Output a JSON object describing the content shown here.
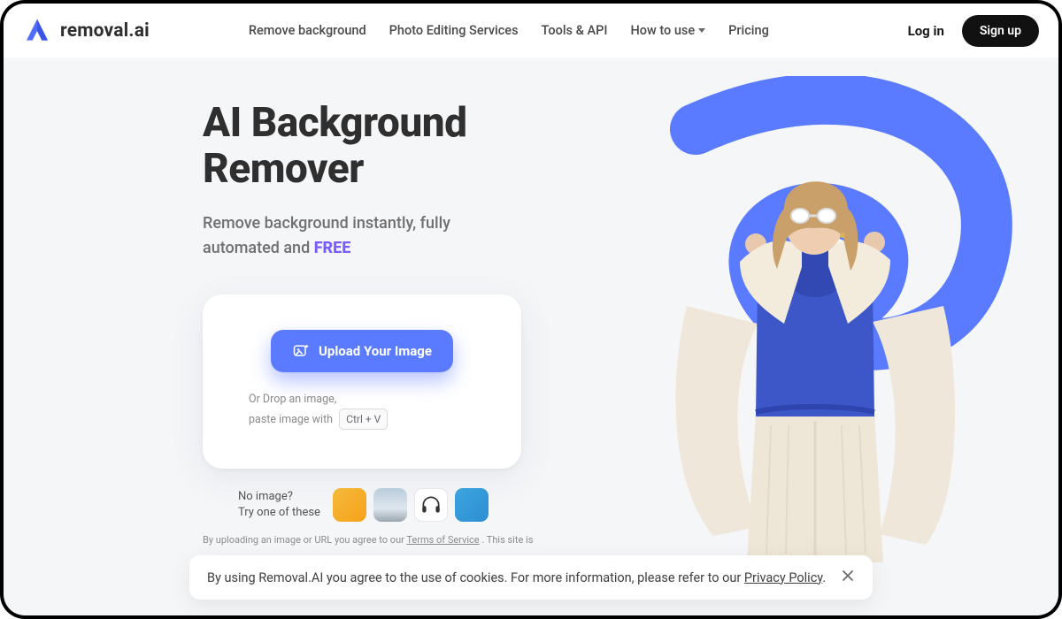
{
  "brand": {
    "name": "removal.ai"
  },
  "nav": {
    "items": [
      {
        "label": "Remove background"
      },
      {
        "label": "Photo Editing Services"
      },
      {
        "label": "Tools & API"
      },
      {
        "label": "How to use",
        "dropdown": true
      },
      {
        "label": "Pricing"
      }
    ],
    "login": "Log in",
    "signup": "Sign up"
  },
  "hero": {
    "title_line1": "AI Background",
    "title_line2": "Remover",
    "subtitle_prefix": "Remove background instantly, fully automated and ",
    "subtitle_free": "FREE",
    "upload_label": "Upload Your Image",
    "hint_line1": "Or Drop an image,",
    "hint_line2_prefix": "paste image with",
    "hint_kbd": "Ctrl + V",
    "samples_line1": "No image?",
    "samples_line2": "Try one of these",
    "sample_alts": [
      "sample-person",
      "sample-car",
      "sample-headphones",
      "sample-dog"
    ],
    "legal_prefix": "By uploading an image or URL you agree to our ",
    "legal_tos": "Terms of Service",
    "legal_suffix": " . This site is"
  },
  "cookie": {
    "text_prefix": "By using Removal.AI you agree to the use of cookies. For more information, please refer to our ",
    "privacy": "Privacy Policy",
    "text_suffix": "."
  },
  "colors": {
    "accent": "#5a7bff",
    "free": "#7a5cff"
  }
}
